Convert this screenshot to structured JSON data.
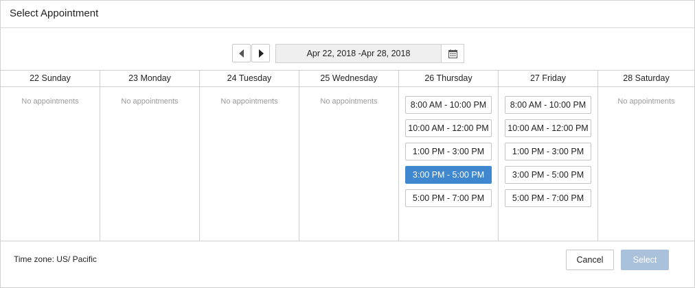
{
  "dialog": {
    "title": "Select Appointment"
  },
  "navigation": {
    "prev_icon": "triangle-left-icon",
    "next_icon": "triangle-right-icon",
    "date_range": "Apr 22, 2018 -Apr 28, 2018",
    "calendar_icon": "calendar-icon"
  },
  "days": [
    {
      "label": "22 Sunday",
      "empty_text": "No appointments",
      "slots": []
    },
    {
      "label": "23 Monday",
      "empty_text": "No appointments",
      "slots": []
    },
    {
      "label": "24 Tuesday",
      "empty_text": "No appointments",
      "slots": []
    },
    {
      "label": "25 Wednesday",
      "empty_text": "No appointments",
      "slots": []
    },
    {
      "label": "26 Thursday",
      "empty_text": "",
      "slots": [
        {
          "label": "8:00 AM - 10:00 PM",
          "selected": false
        },
        {
          "label": "10:00 AM - 12:00 PM",
          "selected": false
        },
        {
          "label": "1:00 PM - 3:00 PM",
          "selected": false
        },
        {
          "label": "3:00 PM - 5:00 PM",
          "selected": true
        },
        {
          "label": "5:00 PM - 7:00 PM",
          "selected": false
        }
      ]
    },
    {
      "label": "27 Friday",
      "empty_text": "",
      "slots": [
        {
          "label": "8:00 AM - 10:00 PM",
          "selected": false
        },
        {
          "label": "10:00 AM - 12:00 PM",
          "selected": false
        },
        {
          "label": "1:00 PM - 3:00 PM",
          "selected": false
        },
        {
          "label": "3:00 PM - 5:00 PM",
          "selected": false
        },
        {
          "label": "5:00 PM - 7:00 PM",
          "selected": false
        }
      ]
    },
    {
      "label": "28 Saturday",
      "empty_text": "No appointments",
      "slots": []
    }
  ],
  "footer": {
    "timezone": "Time zone: US/ Pacific",
    "cancel_label": "Cancel",
    "select_label": "Select"
  },
  "colors": {
    "selected_slot": "#3f88cf",
    "select_button_disabled": "#a9c1db"
  }
}
